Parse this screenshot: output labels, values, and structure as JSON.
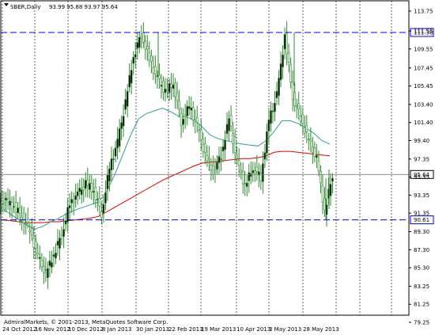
{
  "header": {
    "symbol_label": "SBER,Daily",
    "ohlc_text": "93.99 95.88 93.97 95.64"
  },
  "copyright": "AdmiralMarkets, © 2001-2013, MetaQuotes Software Corp.",
  "colors": {
    "background": "#ffffff",
    "candle": "#2e8b2e",
    "ma_fast": "#2aa198",
    "ma_slow": "#e00000",
    "level_line": "#0000ff",
    "price_line": "#808080",
    "price_badge_bg": "#ffffff"
  },
  "chart_data": {
    "type": "candlestick",
    "instrument": "SBER",
    "timeframe": "Daily",
    "y_ticks": [
      "113.75",
      "111.55",
      "109.55",
      "107.45",
      "105.45",
      "103.40",
      "101.40",
      "99.40",
      "97.35",
      "95.35",
      "93.35",
      "91.35",
      "89.30",
      "87.30",
      "85.30",
      "83.25",
      "81.25",
      "79.25"
    ],
    "ylim": [
      79.25,
      114.6
    ],
    "x_ticks": [
      "24 Oct 2012",
      "16 Nov 2012",
      "10 Dec 2012",
      "8 Jan 2013",
      "30 Jan 2013",
      "22 Feb 2013",
      "19 Mar 2013",
      "10 Apr 2013",
      "3 May 2013",
      "28 May 2013"
    ],
    "horizontal_levels": [
      {
        "value": 111.38,
        "label": "111.38"
      },
      {
        "value": 90.61,
        "label": "90.61"
      }
    ],
    "current_price": {
      "value": 95.64,
      "label": "95.64"
    },
    "close_series_by_week": [
      92.6,
      92.1,
      91.0,
      89.5,
      86.5,
      84.6,
      86.8,
      89.0,
      92.4,
      93.4,
      94.6,
      93.9,
      91.3,
      96.4,
      99.2,
      103.6,
      108.8,
      111.2,
      108.4,
      106.2,
      104.8,
      105.8,
      101.5,
      103.2,
      101.0,
      97.8,
      95.9,
      97.8,
      101.8,
      97.0,
      94.4,
      96.4,
      95.3,
      101.6,
      104.4,
      111.0,
      104.3,
      101.9,
      99.4,
      97.3,
      91.6,
      95.6
    ],
    "ma_fast_by_week": [
      91.8,
      91.2,
      90.6,
      90.0,
      89.6,
      89.9,
      90.4,
      90.8,
      91.3,
      91.7,
      92.0,
      92.3,
      92.6,
      93.8,
      95.6,
      97.8,
      100.0,
      101.8,
      102.4,
      102.7,
      103.0,
      102.6,
      102.1,
      102.0,
      101.7,
      100.9,
      100.0,
      99.6,
      99.4,
      99.2,
      99.0,
      98.9,
      98.8,
      99.4,
      100.4,
      101.6,
      101.6,
      101.3,
      100.8,
      100.2,
      99.4,
      99.0
    ],
    "ma_slow_by_week": [
      90.6,
      90.5,
      90.4,
      90.3,
      90.3,
      90.3,
      90.4,
      90.4,
      90.5,
      90.6,
      90.7,
      90.8,
      91.0,
      91.5,
      92.0,
      92.5,
      93.0,
      93.5,
      94.0,
      94.5,
      95.0,
      95.4,
      95.8,
      96.2,
      96.6,
      96.9,
      97.0,
      97.1,
      97.2,
      97.3,
      97.4,
      97.4,
      97.5,
      97.7,
      98.1,
      98.2,
      98.2,
      98.1,
      98.0,
      97.9,
      97.8,
      97.7
    ]
  }
}
